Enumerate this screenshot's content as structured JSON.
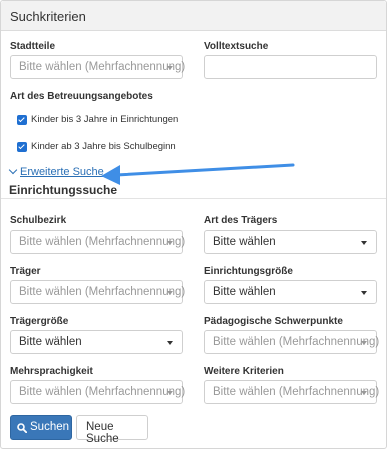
{
  "panel": {
    "title": "Suchkriterien"
  },
  "basic": {
    "stadtteile": {
      "label": "Stadtteile",
      "placeholder": "Bitte wählen (Mehrfachnennung)"
    },
    "volltextsuche": {
      "label": "Volltextsuche",
      "value": ""
    },
    "betreuung": {
      "label": "Art des Betreuungsangebotes",
      "options": [
        {
          "label": "Kinder bis 3 Jahre in Einrichtungen",
          "checked": true
        },
        {
          "label": "Kinder ab 3 Jahre bis Schulbeginn",
          "checked": true
        }
      ]
    }
  },
  "advanced_link": "Erweiterte Suche",
  "advanced": {
    "title": "Einrichtungssuche",
    "schulbezirk": {
      "label": "Schulbezirk",
      "value": "Bitte wählen (Mehrfachnennung)"
    },
    "art_traeger": {
      "label": "Art des Trägers",
      "value": "Bitte wählen"
    },
    "traeger": {
      "label": "Träger",
      "value": "Bitte wählen (Mehrfachnennung)"
    },
    "einrichtungsgroesse": {
      "label": "Einrichtungsgröße",
      "value": "Bitte wählen"
    },
    "traegergroesse": {
      "label": "Trägergröße",
      "value": "Bitte wählen"
    },
    "schwerpunkte": {
      "label": "Pädagogische Schwerpunkte",
      "value": "Bitte wählen (Mehrfachnennung)"
    },
    "mehrsprachigkeit": {
      "label": "Mehrsprachigkeit",
      "value": "Bitte wählen (Mehrfachnennung)"
    },
    "weitere": {
      "label": "Weitere Kriterien",
      "value": "Bitte wählen (Mehrfachnennung)"
    }
  },
  "buttons": {
    "search": "Suchen",
    "new_search": "Neue Suche"
  },
  "icons": {
    "search": "search-icon",
    "chevron": "chevron-down-icon",
    "annotation": "arrow-left-icon"
  },
  "colors": {
    "primary": "#3a77b8",
    "link": "#2a6fb5",
    "checkbox": "#1f6fd1",
    "arrow": "#3f8ee6"
  }
}
